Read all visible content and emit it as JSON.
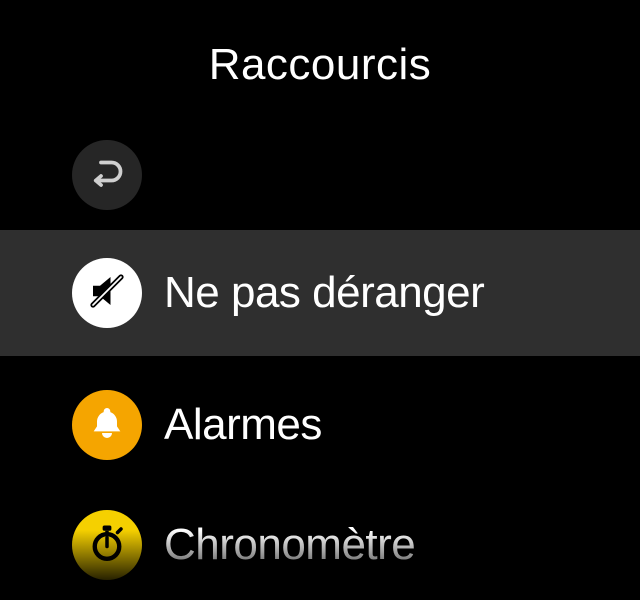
{
  "header": {
    "title": "Raccourcis"
  },
  "icons": {
    "back": "return-arrow-icon",
    "dnd": "mute-icon",
    "alarms": "bell-icon",
    "stopwatch": "stopwatch-icon"
  },
  "items": {
    "dnd": {
      "label": "Ne pas déranger"
    },
    "alarms": {
      "label": "Alarmes"
    },
    "stopwatch": {
      "label": "Chronomètre"
    }
  },
  "colors": {
    "bg": "#000000",
    "row_selected_bg": "#2f2f2f",
    "back_btn_bg": "#262626",
    "dnd_icon_bg": "#ffffff",
    "alarm_icon_bg": "#f5a500",
    "stopwatch_icon_bg": "#f5d000"
  }
}
